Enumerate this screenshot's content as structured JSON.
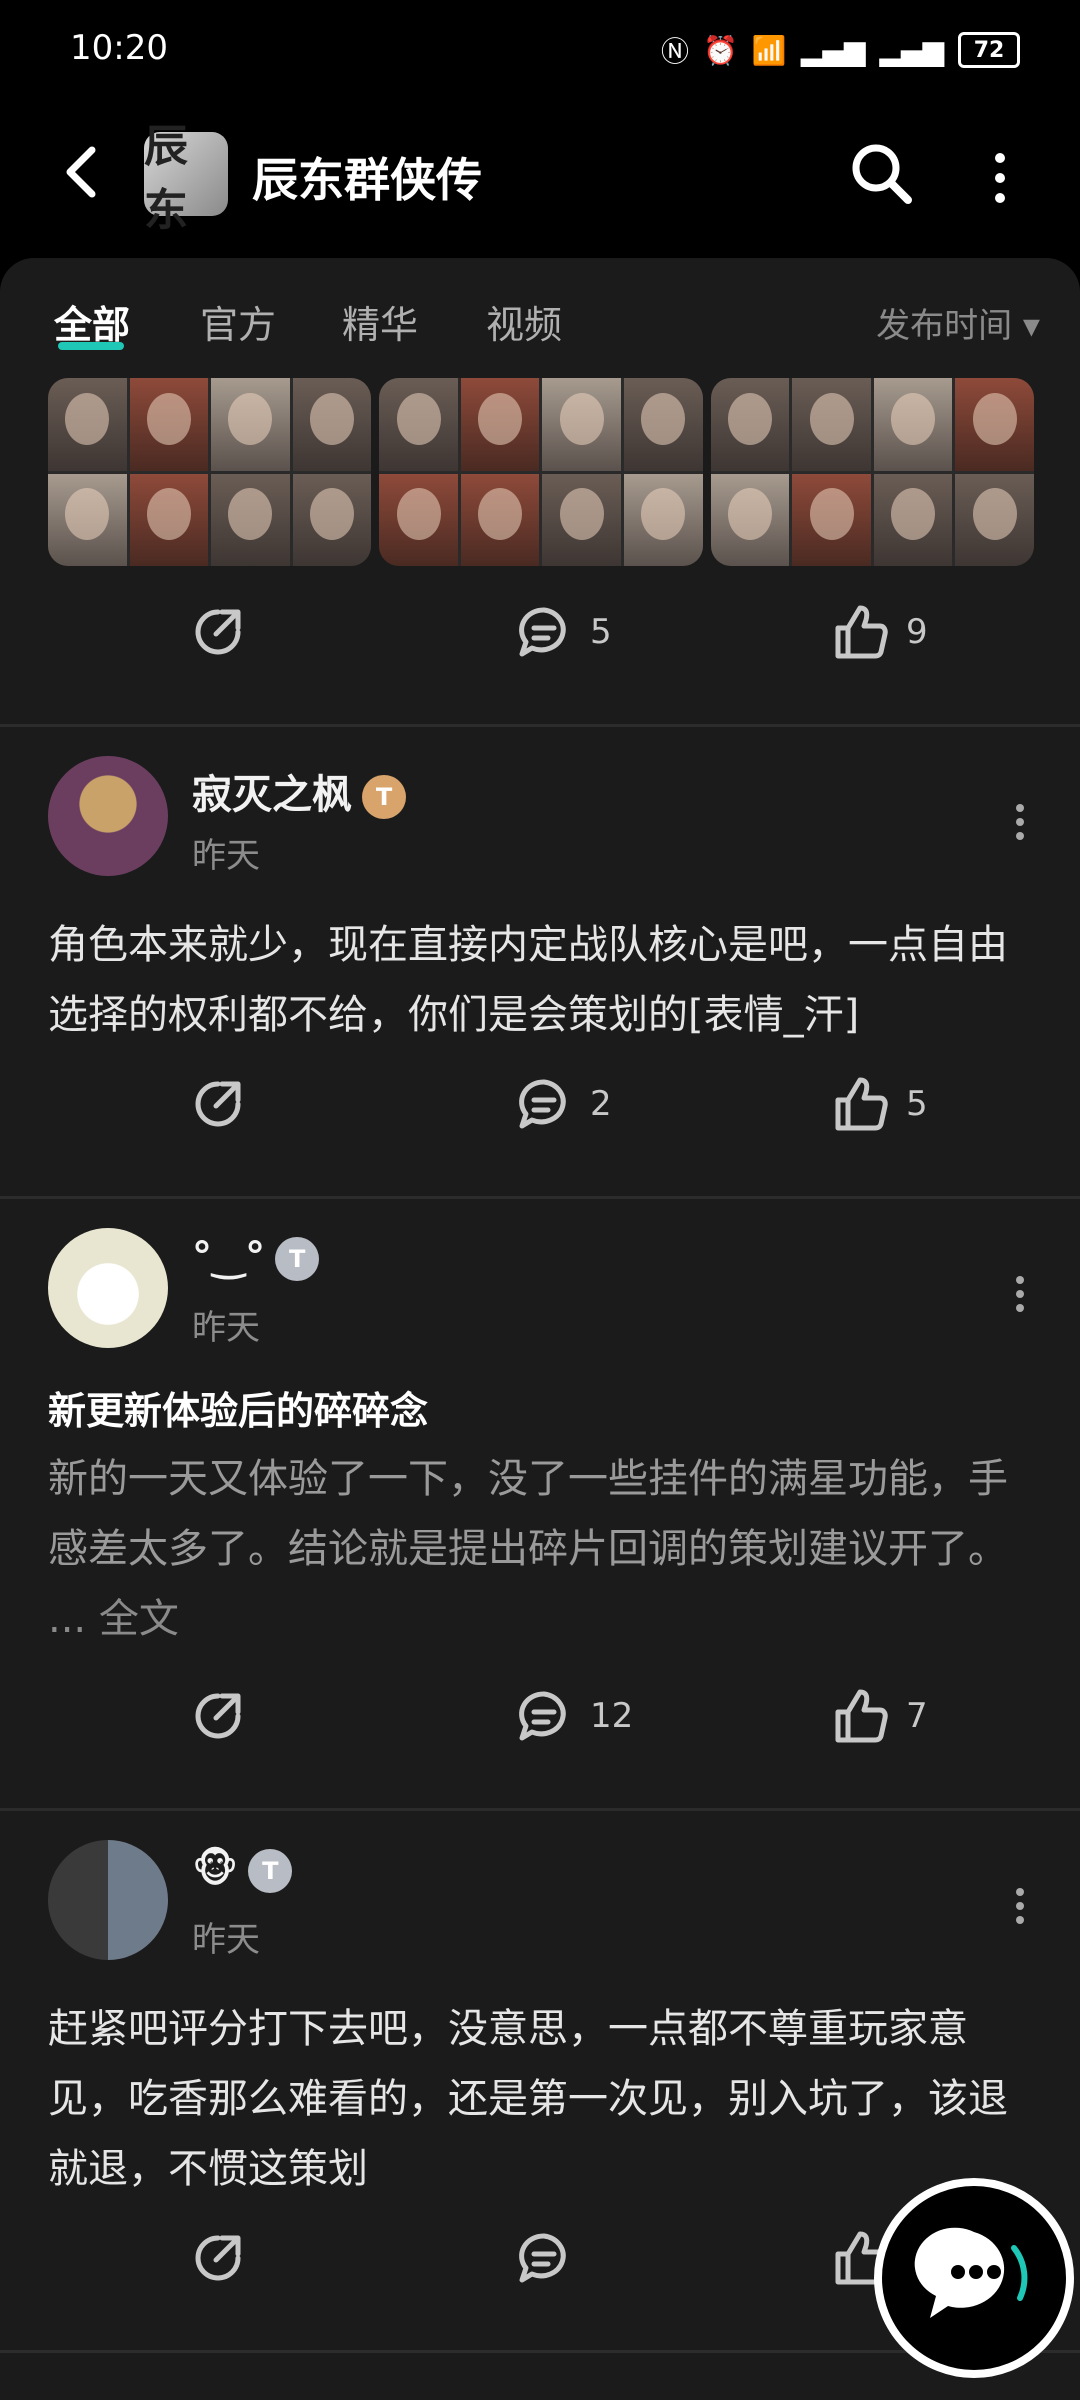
{
  "status": {
    "time": "10:20",
    "battery": "72"
  },
  "header": {
    "title": "辰东群侠传",
    "logo_text": "辰东"
  },
  "tabs": [
    {
      "label": "全部"
    },
    {
      "label": "官方"
    },
    {
      "label": "精华"
    },
    {
      "label": "视频"
    }
  ],
  "sort": {
    "label": "发布时间 ▾"
  },
  "posts": [
    {
      "actions": {
        "comments": "5",
        "likes": "9"
      }
    },
    {
      "author": "寂灭之枫",
      "time": "昨天",
      "badge": "T",
      "content": "角色本来就少，现在直接内定战队核心是吧，一点自由选择的权利都不给，你们是会策划的[表情_汗]",
      "actions": {
        "comments": "2",
        "likes": "5"
      }
    },
    {
      "author": "°‿°",
      "time": "昨天",
      "badge": "T",
      "title": "新更新体验后的碎碎念",
      "excerpt": "新的一天又体验了一下，没了一些挂件的满星功能，手感差太多了。结论就是提出碎片回调的策划建议开了。",
      "read_more": "... 全文",
      "actions": {
        "comments": "12",
        "likes": "7"
      }
    },
    {
      "author": "🐵",
      "time": "昨天",
      "badge": "T",
      "content": "赶紧吧评分打下去吧，没意思，一点都不尊重玩家意见，吃香那么难看的，还是第一次见，别入坑了，该退就退，不惯这策划",
      "actions": {
        "comments": "",
        "likes": ""
      }
    }
  ]
}
